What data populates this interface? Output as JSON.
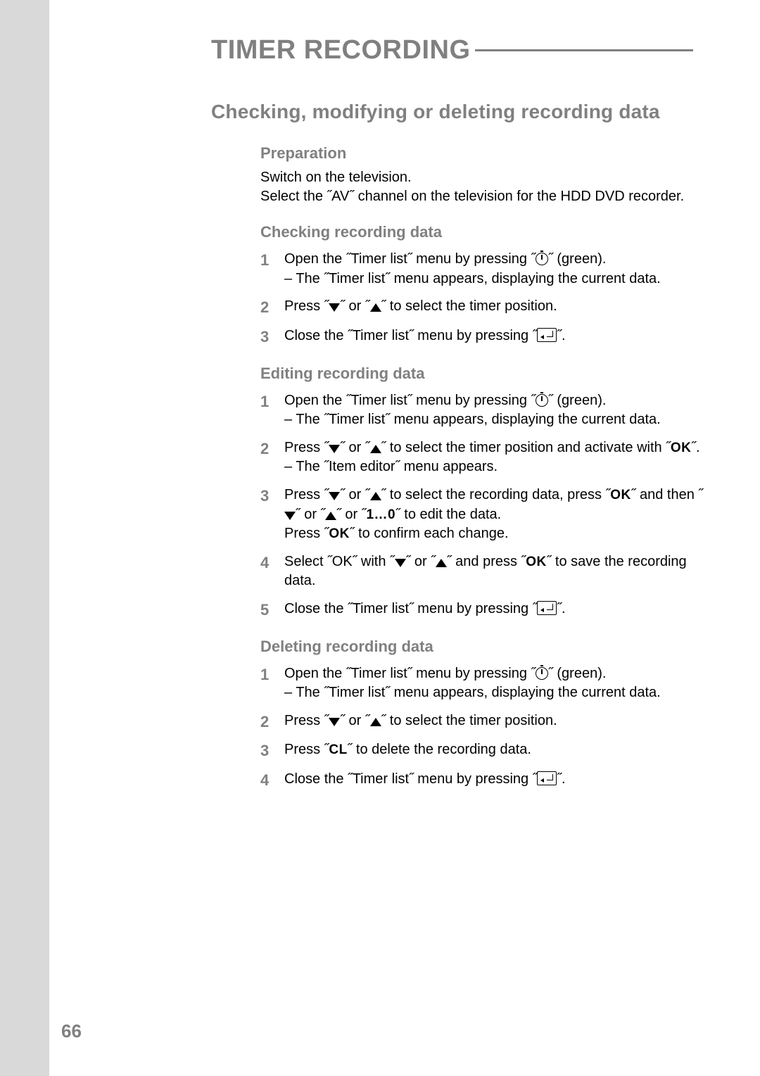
{
  "page_number": "66",
  "heading": "TIMER RECORDING",
  "sub_heading": "Checking, modifying or deleting recording data",
  "preparation": {
    "title": "Preparation",
    "lines": [
      "Switch on the television.",
      "Select the ˝AV˝ channel on the television for the HDD DVD recorder."
    ]
  },
  "checking": {
    "title": "Checking recording data",
    "steps": [
      {
        "n": "1",
        "open_pre": "Open the ˝Timer list˝ menu by pressing ˝",
        "open_post": "˝ (green).",
        "result": "– The ˝Timer list˝ menu appears, displaying the current data."
      },
      {
        "n": "2",
        "press_pre": "Press ˝",
        "press_mid": "˝ or ˝",
        "press_post": "˝ to select the timer position."
      },
      {
        "n": "3",
        "close_pre": "Close the ˝Timer list˝ menu by pressing ˝",
        "close_post": "˝."
      }
    ]
  },
  "editing": {
    "title": "Editing recording data",
    "steps": [
      {
        "n": "1",
        "open_pre": "Open the ˝Timer list˝ menu by pressing ˝",
        "open_post": "˝ (green).",
        "result": "– The ˝Timer list˝ menu appears, displaying the current data."
      },
      {
        "n": "2",
        "l1_pre": "Press ˝",
        "l1_mid": "˝ or ˝",
        "l1_post": "˝ to select the timer position and activate with ˝",
        "l1_end": "˝.",
        "result": "– The ˝Item editor˝ menu appears."
      },
      {
        "n": "3",
        "l1_pre": "Press ˝",
        "l1_mid": "˝ or ˝",
        "l1_post": "˝ to select the recording data, press ˝",
        "l1_end": "˝ and then ˝",
        "l1_b": "˝ or ˝",
        "l1_c": "˝ or ˝",
        "l1_d": "˝ to edit the data.",
        "l2_pre": "Press ˝",
        "l2_post": "˝ to confirm each change."
      },
      {
        "n": "4",
        "pre": "Select ˝OK˝ with ˝",
        "mid": "˝ or ˝",
        "post": "˝ and press ˝",
        "end": "˝ to save the recording data."
      },
      {
        "n": "5",
        "close_pre": "Close the ˝Timer list˝ menu by pressing ˝",
        "close_post": "˝."
      }
    ]
  },
  "deleting": {
    "title": "Deleting recording data",
    "steps": [
      {
        "n": "1",
        "open_pre": "Open the ˝Timer list˝ menu by pressing ˝",
        "open_post": "˝ (green).",
        "result": "– The ˝Timer list˝ menu appears, displaying the current data."
      },
      {
        "n": "2",
        "press_pre": "Press ˝",
        "press_mid": "˝ or ˝",
        "press_post": "˝ to select the timer position."
      },
      {
        "n": "3",
        "pre": "Press ˝",
        "post": "˝ to delete the recording data."
      },
      {
        "n": "4",
        "close_pre": "Close the ˝Timer list˝ menu by pressing ˝",
        "close_post": "˝."
      }
    ]
  },
  "glyphs": {
    "ok": "OK",
    "cl": "CL",
    "onezero": "1…0"
  }
}
